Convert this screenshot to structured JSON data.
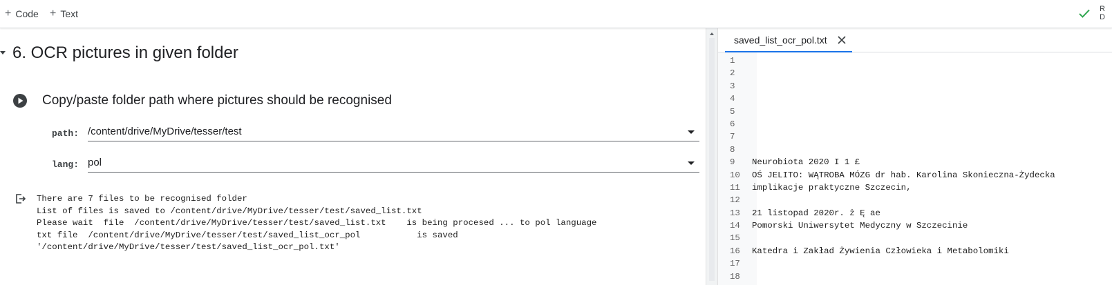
{
  "toolbar": {
    "code_label": "Code",
    "text_label": "Text",
    "status_text": "R\nD"
  },
  "notebook": {
    "section_title": "6. OCR pictures in given folder",
    "form_title": "Copy/paste folder path where pictures should be recognised",
    "fields": {
      "path": {
        "label": "path:",
        "value": "/content/drive/MyDrive/tesser/test"
      },
      "lang": {
        "label": "lang:",
        "value": "pol"
      }
    },
    "output_lines": [
      "There are 7 files to be recognised folder",
      "List of files is saved to /content/drive/MyDrive/tesser/test/saved_list.txt",
      "Please wait  file  /content/drive/MyDrive/tesser/test/saved_list.txt    is being procesed ... to pol language",
      "txt file  /content/drive/MyDrive/tesser/test/saved_list_ocr_pol           is saved",
      "'/content/drive/MyDrive/tesser/test/saved_list_ocr_pol.txt'"
    ]
  },
  "file_viewer": {
    "tab_name": "saved_list_ocr_pol.txt",
    "lines": [
      {
        "num": "1",
        "text": ""
      },
      {
        "num": "2",
        "text": ""
      },
      {
        "num": "3",
        "text": ""
      },
      {
        "num": "4",
        "text": ""
      },
      {
        "num": "5",
        "text": ""
      },
      {
        "num": "6",
        "text": ""
      },
      {
        "num": "7",
        "text": ""
      },
      {
        "num": "8",
        "text": ""
      },
      {
        "num": "9",
        "text": "Neurobiota 2020 I 1 £"
      },
      {
        "num": "10",
        "text": "OŚ JELITO: WĄTROBA MÓZG dr hab. Karolina Skonieczna-Żydecka"
      },
      {
        "num": "11",
        "text": "implikacje praktyczne Szczecin,"
      },
      {
        "num": "12",
        "text": ""
      },
      {
        "num": "13",
        "text": "21 listopad 2020r. ż Ę ae"
      },
      {
        "num": "14",
        "text": "Pomorski Uniwersytet Medyczny w Szczecinie"
      },
      {
        "num": "15",
        "text": ""
      },
      {
        "num": "16",
        "text": "Katedra i Zakład Żywienia Człowieka i Metabolomiki"
      },
      {
        "num": "17",
        "text": ""
      },
      {
        "num": "18",
        "text": ""
      }
    ]
  },
  "colors": {
    "accent": "#1a73e8",
    "status_check": "#34a853"
  }
}
